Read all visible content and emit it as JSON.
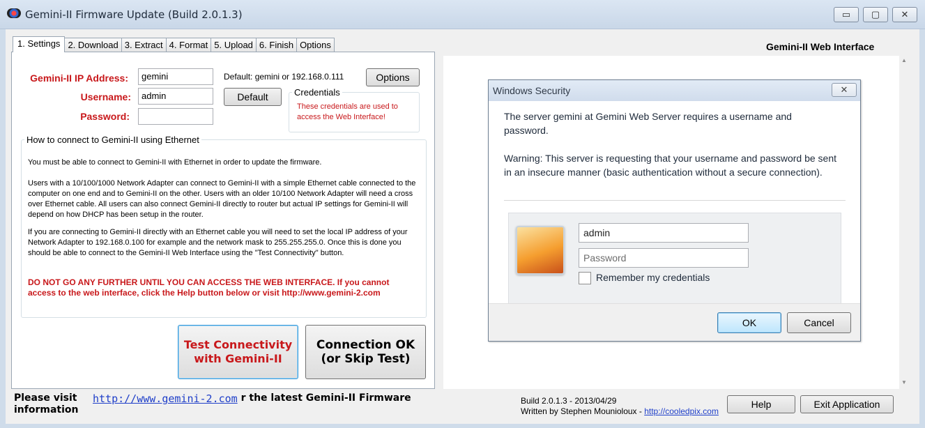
{
  "window": {
    "title": "Gemini-II Firmware Update (Build 2.0.1.3)",
    "min": "▭",
    "max": "▢",
    "close": "✕"
  },
  "tabs": [
    "1. Settings",
    "2. Download",
    "3. Extract",
    "4. Format",
    "5. Upload",
    "6. Finish",
    "Options"
  ],
  "settings": {
    "ip_label": "Gemini-II IP Address:",
    "ip_value": "gemini",
    "user_label": "Username:",
    "user_value": "admin",
    "pass_label": "Password:",
    "pass_value": "",
    "default_hint": "Default: gemini or 192.168.0.111",
    "options_button": "Options",
    "default_button": "Default",
    "credentials_title": "Credentials",
    "credentials_note": "These credentials are used to access the Web Interface!"
  },
  "howto": {
    "title": "How to connect to Gemini-II using Ethernet",
    "p1": "You must be able to connect to Gemini-II with Ethernet in order to update the firmware.",
    "p2": "Users with a 10/100/1000 Network Adapter can connect to Gemini-II with a simple Ethernet cable connected to the computer on one end and to Gemini-II on the other. Users with an older 10/100 Network Adapter will need a cross over Ethernet cable. All users can also connect Gemini-II directly to router but actual IP settings for Gemini-II will depend on how DHCP has been setup in the router.",
    "p3": "If you are connecting to Gemini-II directly with an Ethernet cable you will need to set the local IP address of your Network Adapter to 192.168.0.100 for example and the network mask to 255.255.255.0. Once this is done you should be able to connect to the Gemini-II Web Interface using the \"Test Connectivity\" button.",
    "warning": "DO NOT GO ANY FURTHER UNTIL YOU CAN ACCESS THE WEB INTERFACE. If you cannot access to the web interface, click the Help button below or visit http://www.gemini-2.com"
  },
  "actions": {
    "test_line1": "Test Connectivity",
    "test_line2": "with Gemini-II",
    "ok_line1": "Connection OK",
    "ok_line2": "(or Skip Test)"
  },
  "web": {
    "header": "Gemini-II Web Interface"
  },
  "dialog": {
    "title": "Windows Security",
    "message": "The server gemini at Gemini Web Server requires a username and password.",
    "warning": "Warning: This server is requesting that your username and password be sent in an insecure manner (basic authentication without a secure connection).",
    "username": "admin",
    "password_placeholder": "Password",
    "remember": "Remember my credentials",
    "ok": "OK",
    "cancel": "Cancel"
  },
  "footer": {
    "note_a": "Please visit",
    "note_b": "information",
    "link": "http://www.gemini-2.com",
    "tail": "or the latest Gemini-II Firmware",
    "build": "Build 2.0.1.3 - 2013/04/29",
    "written_by": "Written by Stephen Mounioloux - ",
    "author_link": "http://cooledpix.com",
    "help": "Help",
    "exit": "Exit Application"
  }
}
